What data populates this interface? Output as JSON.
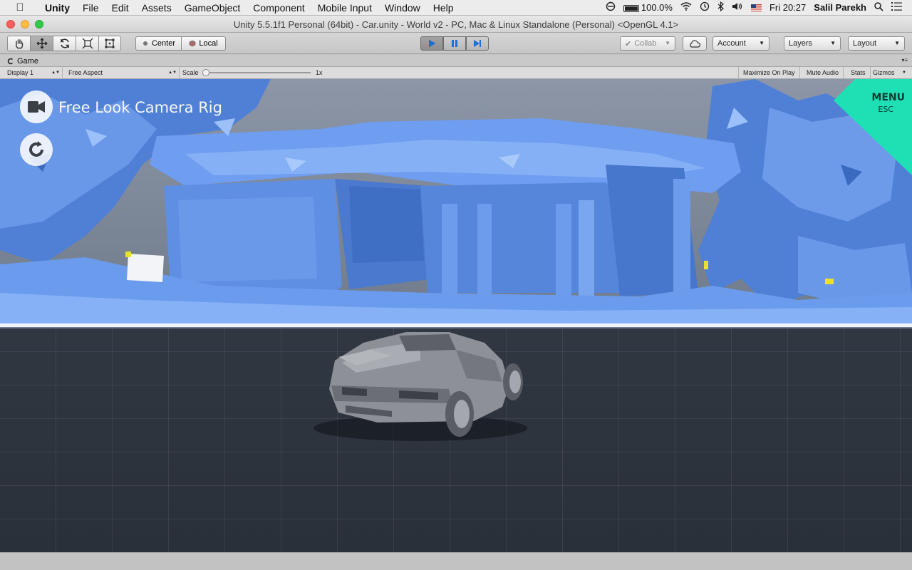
{
  "menubar": {
    "app": "Unity",
    "items": [
      "File",
      "Edit",
      "Assets",
      "GameObject",
      "Component",
      "Mobile Input",
      "Window",
      "Help"
    ],
    "battery": "100.0%",
    "clock": "Fri 20:27",
    "user": "Salil Parekh"
  },
  "window": {
    "title": "Unity 5.5.1f1 Personal (64bit) - Car.unity - World v2 - PC, Mac & Linux Standalone (Personal) <OpenGL 4.1>"
  },
  "toolbar": {
    "pivot_label": "Center",
    "space_label": "Local",
    "collab_label": "Collab",
    "account_label": "Account",
    "layers_label": "Layers",
    "layout_label": "Layout"
  },
  "game_panel": {
    "tab_label": "Game",
    "display_label": "Display 1",
    "aspect_label": "Free Aspect",
    "scale_label": "Scale",
    "scale_value": "1x",
    "scale_level": 0.0,
    "maximize_label": "Maximize On Play",
    "mute_label": "Mute Audio",
    "stats_label": "Stats",
    "gizmos_label": "Gizmos"
  },
  "game_view": {
    "camera_label": "Free Look Camera Rig",
    "menu_label": "MENU",
    "menu_sub": "ESC",
    "menu_color": "#1fe0b4",
    "scan_color": "#5b8fe6"
  }
}
